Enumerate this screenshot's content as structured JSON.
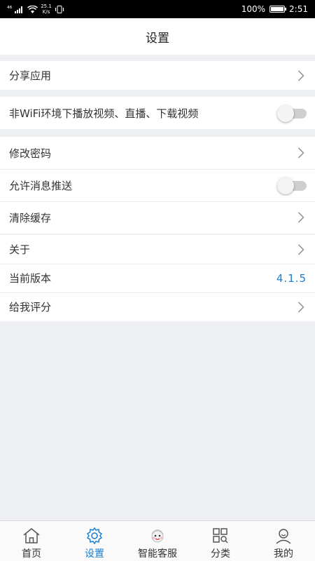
{
  "status_bar": {
    "signal": "⁴⁶",
    "speed_value": "25.1",
    "speed_unit": "K/s",
    "battery_percent": "100%",
    "time": "2:51"
  },
  "header": {
    "title": "设置"
  },
  "groups": {
    "share": {
      "label": "分享应用"
    },
    "wifi": {
      "label": "非WiFi环境下播放视频、直播、下载视频",
      "toggle_on": false
    },
    "account": {
      "change_password": "修改密码",
      "push": "允许消息推送",
      "push_on": false,
      "clear_cache": "清除缓存"
    },
    "about": {
      "about": "关于",
      "version_label": "当前版本",
      "version_value": "4.1.5",
      "rate": "给我评分"
    }
  },
  "tabbar": {
    "home": "首页",
    "settings": "设置",
    "service": "智能客服",
    "category": "分类",
    "mine": "我的",
    "active_color": "#1a7fd4"
  }
}
